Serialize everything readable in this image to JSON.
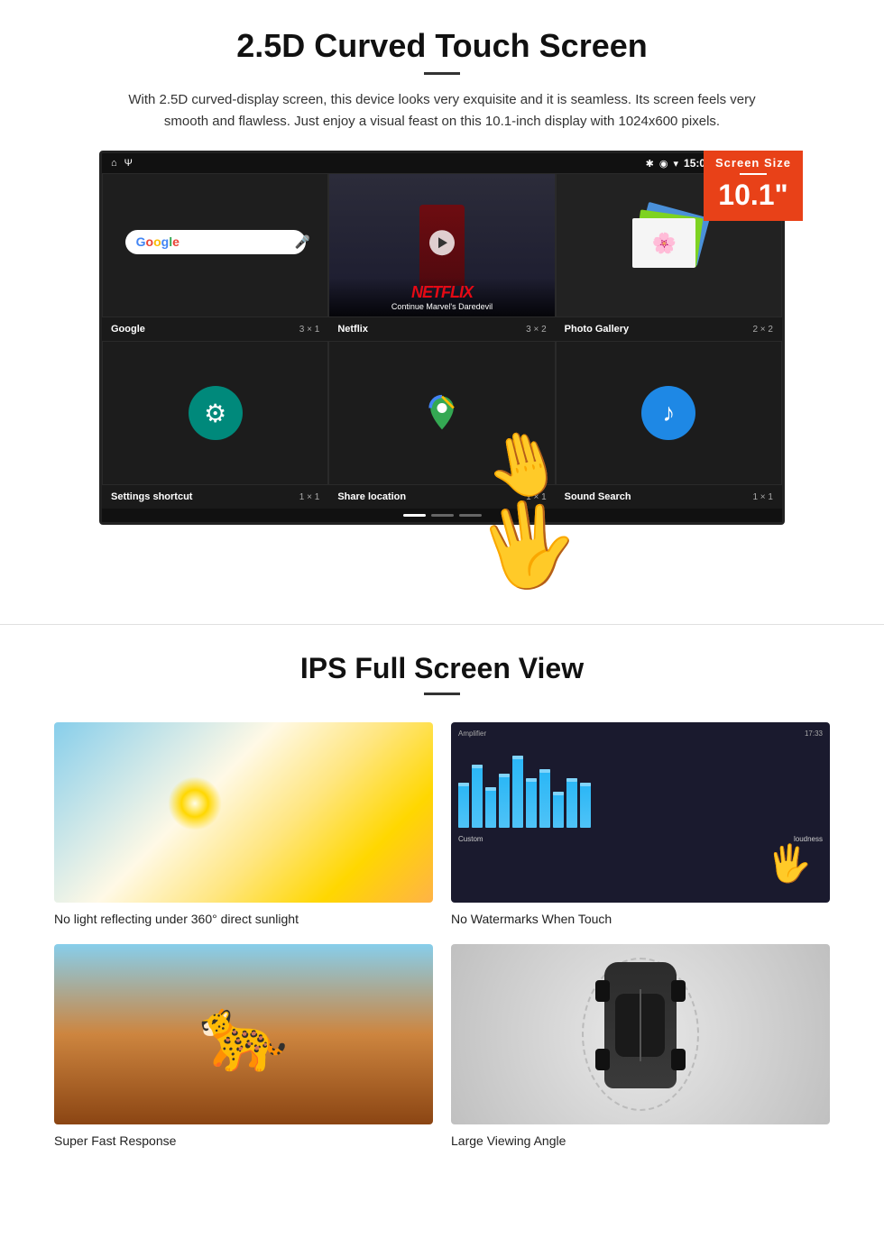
{
  "section1": {
    "title": "2.5D Curved Touch Screen",
    "description": "With 2.5D curved-display screen, this device looks very exquisite and it is seamless. Its screen feels very smooth and flawless. Just enjoy a visual feast on this 10.1-inch display with 1024x600 pixels.",
    "screen_size_badge": {
      "label": "Screen Size",
      "size": "10.1\""
    },
    "status_bar": {
      "time": "15:06"
    },
    "apps_row1": [
      {
        "name": "Google",
        "size": "3 × 1"
      },
      {
        "name": "Netflix",
        "size": "3 × 2"
      },
      {
        "name": "Photo Gallery",
        "size": "2 × 2"
      }
    ],
    "apps_row2": [
      {
        "name": "Settings shortcut",
        "size": "1 × 1"
      },
      {
        "name": "Share location",
        "size": "1 × 1"
      },
      {
        "name": "Sound Search",
        "size": "1 × 1"
      }
    ],
    "netflix": {
      "logo": "NETFLIX",
      "subtitle": "Continue Marvel's Daredevil"
    }
  },
  "section2": {
    "title": "IPS Full Screen View",
    "features": [
      {
        "label": "No light reflecting under 360° direct sunlight",
        "type": "sunlight"
      },
      {
        "label": "No Watermarks When Touch",
        "type": "amplifier"
      },
      {
        "label": "Super Fast Response",
        "type": "cheetah"
      },
      {
        "label": "Large Viewing Angle",
        "type": "car"
      }
    ]
  }
}
